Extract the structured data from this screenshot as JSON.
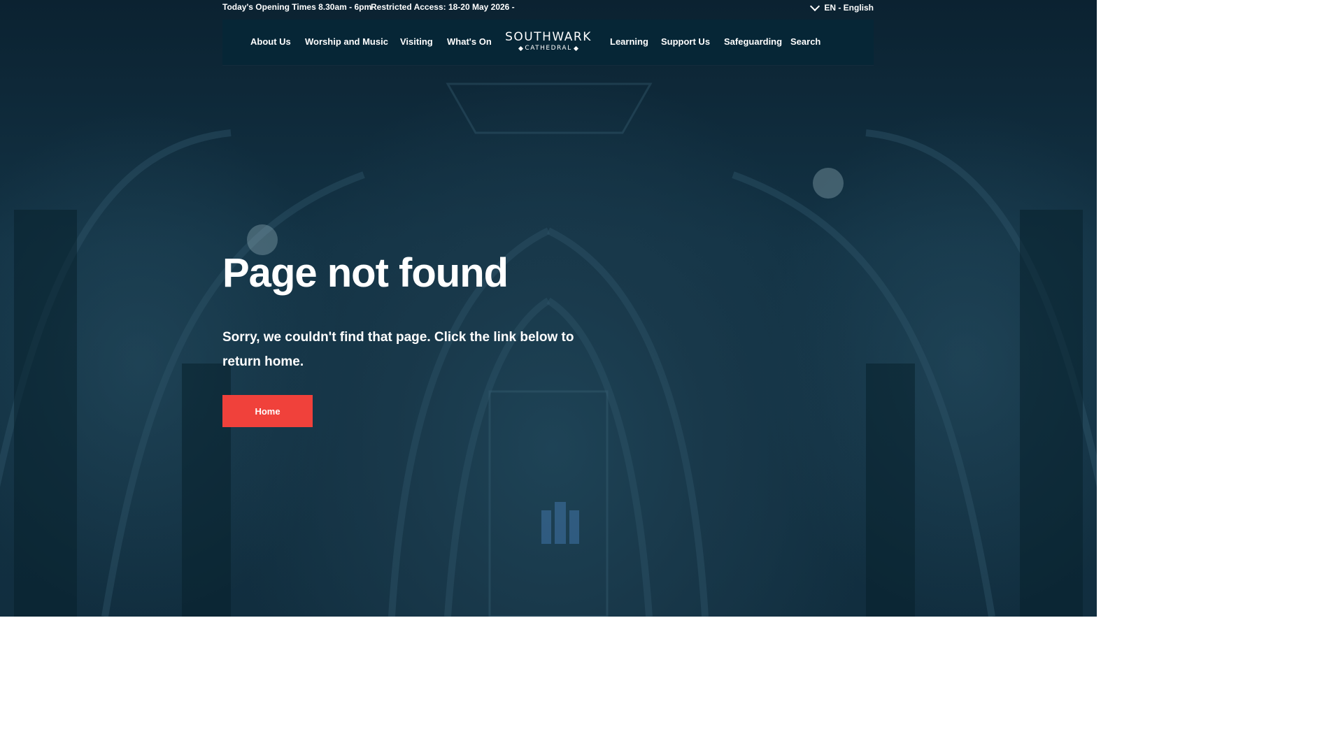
{
  "topbar": {
    "opening_times": "Today's Opening Times 8.30am - 6pm",
    "restricted_access": "Restricted Access: 18-20 May 2026 -",
    "language": "EN - English"
  },
  "nav": {
    "items_left": [
      "About Us",
      "Worship and Music",
      "Visiting",
      "What's On"
    ],
    "items_right": [
      "Learning",
      "Support Us",
      "Safeguarding",
      "Search"
    ]
  },
  "logo": {
    "top": "SOUTHWARK",
    "bottom": "CATHEDRAL"
  },
  "main": {
    "title": "Page not found",
    "description": "Sorry, we couldn't find that page. Click the link below to return home.",
    "home_button": "Home"
  },
  "colors": {
    "nav_background": "#062636",
    "button_accent": "#f0413b",
    "page_background": "#0d2736"
  },
  "icons": {
    "language_toggle": "chevron-down-icon"
  }
}
